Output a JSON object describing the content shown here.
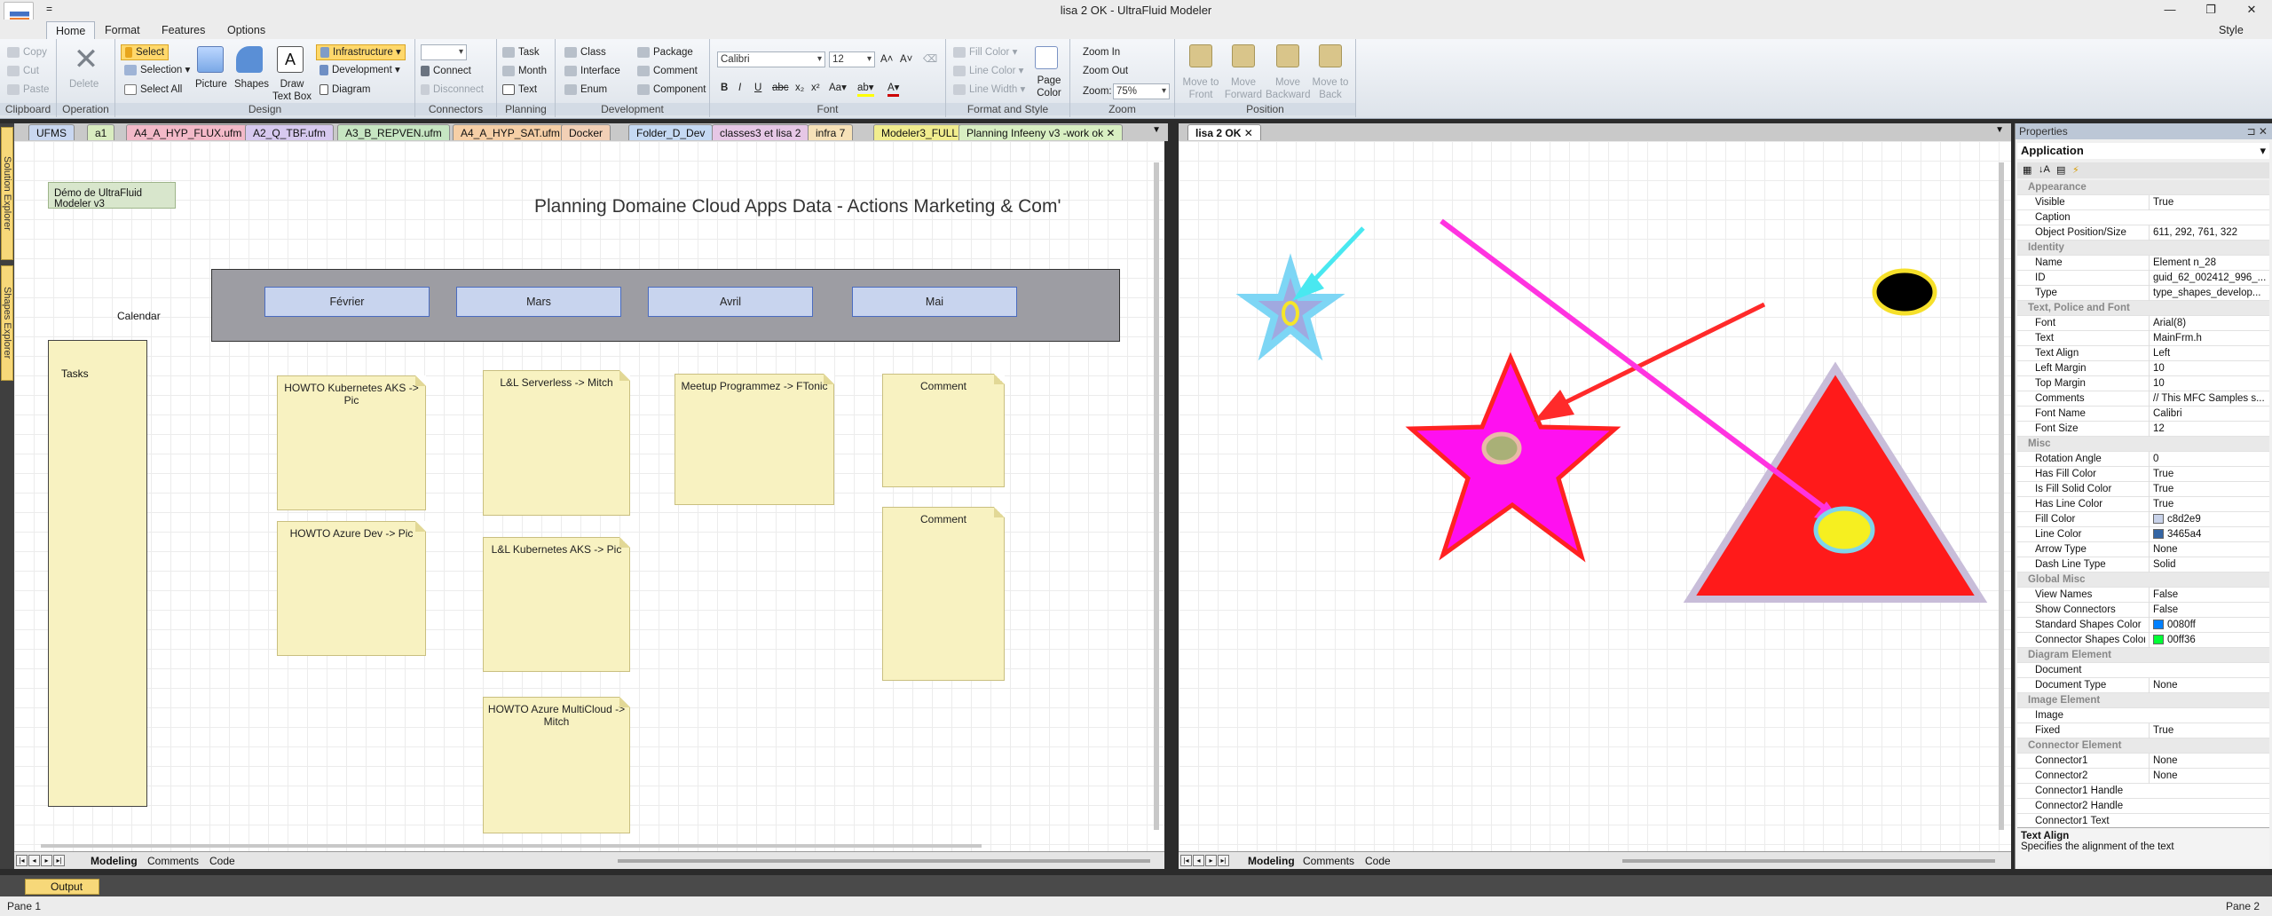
{
  "window": {
    "title": "lisa 2 OK - UltraFluid Modeler",
    "quick_access": "=",
    "style_menu": "Style"
  },
  "ribbon": {
    "tabs": [
      "Home",
      "Format",
      "Features",
      "Options"
    ],
    "clipboard": {
      "copy": "Copy",
      "cut": "Cut",
      "paste": "Paste",
      "label": "Clipboard"
    },
    "operation": {
      "delete": "Delete",
      "label": "Operation"
    },
    "design": {
      "select": "Select",
      "selection": "Selection",
      "select_all": "Select All",
      "picture": "Picture",
      "shapes": "Shapes",
      "draw_text_box": "Draw Text Box",
      "infrastructure": "Infrastructure",
      "development": "Development",
      "diagram": "Diagram",
      "label": "Design"
    },
    "connectors": {
      "connect": "Connect",
      "disconnect": "Disconnect",
      "label": "Connectors"
    },
    "planning": {
      "task": "Task",
      "month": "Month",
      "text": "Text",
      "label": "Planning"
    },
    "development": {
      "class": "Class",
      "interface": "Interface",
      "enum": "Enum",
      "package": "Package",
      "comment": "Comment",
      "component": "Component",
      "label": "Development"
    },
    "font": {
      "name": "Calibri",
      "size": "12",
      "label": "Font"
    },
    "format_style": {
      "fill_color": "Fill Color",
      "line_color": "Line Color",
      "line_width": "Line Width",
      "page_color": "Page Color",
      "label": "Format and Style"
    },
    "zoom": {
      "zoom_in": "Zoom In",
      "zoom_out": "Zoom Out",
      "zoom_label": "Zoom:",
      "zoom_value": "75%",
      "label": "Zoom"
    },
    "position": {
      "move_front": "Move to Front",
      "move_forward": "Move Forward",
      "move_backward": "Move Backward",
      "move_back": "Move to Back",
      "label": "Position"
    }
  },
  "doc_tabs_left": [
    {
      "label": "UFMS",
      "color": "#c9d7f0"
    },
    {
      "label": "a1",
      "color": "#d9ecc0"
    },
    {
      "label": "A4_A_HYP_FLUX.ufm",
      "color": "#f3b9c8"
    },
    {
      "label": "A2_Q_TBF.ufm",
      "color": "#d7c9ef"
    },
    {
      "label": "A3_B_REPVEN.ufm",
      "color": "#c6e6c2"
    },
    {
      "label": "A4_A_HYP_SAT.ufm",
      "color": "#f6cfa6"
    },
    {
      "label": "Docker",
      "color": "#f2d0b6"
    },
    {
      "label": "Folder_D_Dev",
      "color": "#c5d9f3"
    },
    {
      "label": "classes3 et lisa 2",
      "color": "#e6c7e6"
    },
    {
      "label": "infra 7",
      "color": "#f7e2b8"
    },
    {
      "label": "Modeler3_FULL",
      "color": "#f1ed8e"
    },
    {
      "label": "Planning Infeeny v3 -work ok",
      "color": "#d8efc2"
    }
  ],
  "doc_tab_right": "lisa 2 OK",
  "sidebar": {
    "solution_explorer": "Solution Explorer",
    "shapes_explorer": "Shapes Explorer"
  },
  "diagram1": {
    "demo_label": "Démo de UltraFluid Modeler v3",
    "title": "Planning Domaine Cloud Apps Data - Actions Marketing & Com'",
    "calendar": "Calendar",
    "tasks": "Tasks",
    "months": [
      "Février",
      "Mars",
      "Avril",
      "Mai"
    ],
    "notes": [
      "HOWTO Kubernetes AKS -> Pic",
      "HOWTO Azure Dev -> Pic",
      "L&L Serverless -> Mitch",
      "L&L Kubernetes AKS -> Pic",
      "HOWTO Azure MultiCloud -> Mitch",
      "Meetup Programmez -> FTonic",
      "Comment",
      "Comment"
    ]
  },
  "bottom_tabs": [
    "Modeling",
    "Comments",
    "Code"
  ],
  "properties": {
    "header": "Properties",
    "object": "Application",
    "rows": [
      {
        "cat": "Appearance"
      },
      {
        "k": "Visible",
        "v": "True"
      },
      {
        "k": "Caption",
        "v": ""
      },
      {
        "k": "Object Position/Size",
        "v": "611, 292, 761, 322"
      },
      {
        "cat": "Identity"
      },
      {
        "k": "Name",
        "v": "Element n_28"
      },
      {
        "k": "ID",
        "v": "guid_62_002412_996_..."
      },
      {
        "k": "Type",
        "v": "type_shapes_develop..."
      },
      {
        "cat": "Text, Police and Font"
      },
      {
        "k": "Font",
        "v": "Arial(8)"
      },
      {
        "k": "Text",
        "v": "MainFrm.h"
      },
      {
        "k": "Text Align",
        "v": "Left"
      },
      {
        "k": "Left Margin",
        "v": "10"
      },
      {
        "k": "Top Margin",
        "v": "10"
      },
      {
        "k": "Comments",
        "v": "// This MFC Samples s..."
      },
      {
        "k": "Font Name",
        "v": "Calibri"
      },
      {
        "k": "Font Size",
        "v": "12"
      },
      {
        "cat": "Misc"
      },
      {
        "k": "Rotation Angle",
        "v": "0"
      },
      {
        "k": "Has Fill Color",
        "v": "True"
      },
      {
        "k": "Is Fill Solid Color",
        "v": "True"
      },
      {
        "k": "Has Line Color",
        "v": "True"
      },
      {
        "k": "Fill Color",
        "v": "c8d2e9",
        "sw": "#c8d2e9"
      },
      {
        "k": "Line Color",
        "v": "3465a4",
        "sw": "#3465a4"
      },
      {
        "k": "Arrow Type",
        "v": "None"
      },
      {
        "k": "Dash Line Type",
        "v": "Solid"
      },
      {
        "cat": "Global Misc"
      },
      {
        "k": "View Names",
        "v": "False"
      },
      {
        "k": "Show Connectors",
        "v": "False"
      },
      {
        "k": "Standard Shapes Color",
        "v": "0080ff",
        "sw": "#0080ff"
      },
      {
        "k": "Connector Shapes Color",
        "v": "00ff36",
        "sw": "#00ff36"
      },
      {
        "cat": "Diagram Element"
      },
      {
        "k": "Document",
        "v": ""
      },
      {
        "k": "Document Type",
        "v": "None"
      },
      {
        "cat": "Image Element"
      },
      {
        "k": "Image",
        "v": ""
      },
      {
        "k": "Fixed",
        "v": "True"
      },
      {
        "cat": "Connector Element"
      },
      {
        "k": "Connector1",
        "v": "None"
      },
      {
        "k": "Connector2",
        "v": "None"
      },
      {
        "k": "Connector1 Handle",
        "v": ""
      },
      {
        "k": "Connector2 Handle",
        "v": ""
      },
      {
        "k": "Connector1 Text",
        "v": ""
      }
    ],
    "desc_title": "Text Align",
    "desc_text": "Specifies the alignment of the text"
  },
  "output_tab": "Output",
  "status": {
    "left": "Pane 1",
    "right": "Pane 2"
  }
}
